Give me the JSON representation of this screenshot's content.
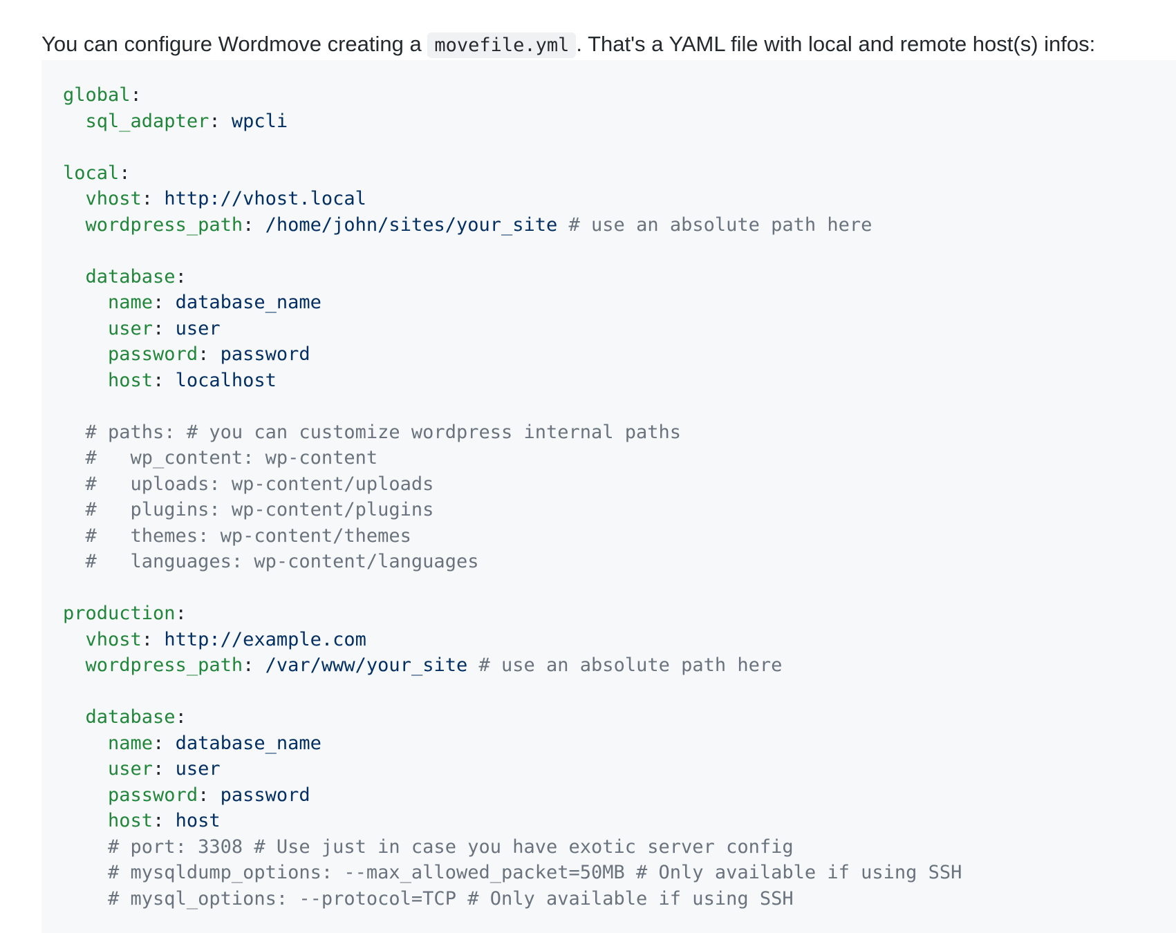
{
  "intro": {
    "before": "You can configure Wordmove creating a ",
    "code": "movefile.yml",
    "after": ". That's a YAML file with local and remote host(s) infos:"
  },
  "code_lines": [
    {
      "indent": "",
      "key": "global",
      "value": "",
      "comment": ""
    },
    {
      "indent": "  ",
      "key": "sql_adapter",
      "value": "wpcli",
      "comment": ""
    },
    {
      "indent": "",
      "key": "",
      "value": "",
      "comment": ""
    },
    {
      "indent": "",
      "key": "local",
      "value": "",
      "comment": ""
    },
    {
      "indent": "  ",
      "key": "vhost",
      "value": "http://vhost.local",
      "comment": ""
    },
    {
      "indent": "  ",
      "key": "wordpress_path",
      "value": "/home/john/sites/your_site",
      "comment": "# use an absolute path here"
    },
    {
      "indent": "",
      "key": "",
      "value": "",
      "comment": ""
    },
    {
      "indent": "  ",
      "key": "database",
      "value": "",
      "comment": ""
    },
    {
      "indent": "    ",
      "key": "name",
      "value": "database_name",
      "comment": ""
    },
    {
      "indent": "    ",
      "key": "user",
      "value": "user",
      "comment": ""
    },
    {
      "indent": "    ",
      "key": "password",
      "value": "password",
      "comment": ""
    },
    {
      "indent": "    ",
      "key": "host",
      "value": "localhost",
      "comment": ""
    },
    {
      "indent": "",
      "key": "",
      "value": "",
      "comment": ""
    },
    {
      "indent": "  ",
      "key": "",
      "value": "",
      "comment": "# paths: # you can customize wordpress internal paths"
    },
    {
      "indent": "  ",
      "key": "",
      "value": "",
      "comment": "#   wp_content: wp-content"
    },
    {
      "indent": "  ",
      "key": "",
      "value": "",
      "comment": "#   uploads: wp-content/uploads"
    },
    {
      "indent": "  ",
      "key": "",
      "value": "",
      "comment": "#   plugins: wp-content/plugins"
    },
    {
      "indent": "  ",
      "key": "",
      "value": "",
      "comment": "#   themes: wp-content/themes"
    },
    {
      "indent": "  ",
      "key": "",
      "value": "",
      "comment": "#   languages: wp-content/languages"
    },
    {
      "indent": "",
      "key": "",
      "value": "",
      "comment": ""
    },
    {
      "indent": "",
      "key": "production",
      "value": "",
      "comment": ""
    },
    {
      "indent": "  ",
      "key": "vhost",
      "value": "http://example.com",
      "comment": ""
    },
    {
      "indent": "  ",
      "key": "wordpress_path",
      "value": "/var/www/your_site",
      "comment": "# use an absolute path here"
    },
    {
      "indent": "",
      "key": "",
      "value": "",
      "comment": ""
    },
    {
      "indent": "  ",
      "key": "database",
      "value": "",
      "comment": ""
    },
    {
      "indent": "    ",
      "key": "name",
      "value": "database_name",
      "comment": ""
    },
    {
      "indent": "    ",
      "key": "user",
      "value": "user",
      "comment": ""
    },
    {
      "indent": "    ",
      "key": "password",
      "value": "password",
      "comment": ""
    },
    {
      "indent": "    ",
      "key": "host",
      "value": "host",
      "comment": ""
    },
    {
      "indent": "    ",
      "key": "",
      "value": "",
      "comment": "# port: 3308 # Use just in case you have exotic server config"
    },
    {
      "indent": "    ",
      "key": "",
      "value": "",
      "comment": "# mysqldump_options: --max_allowed_packet=50MB # Only available if using SSH"
    },
    {
      "indent": "    ",
      "key": "",
      "value": "",
      "comment": "# mysql_options: --protocol=TCP # Only available if using SSH"
    }
  ]
}
